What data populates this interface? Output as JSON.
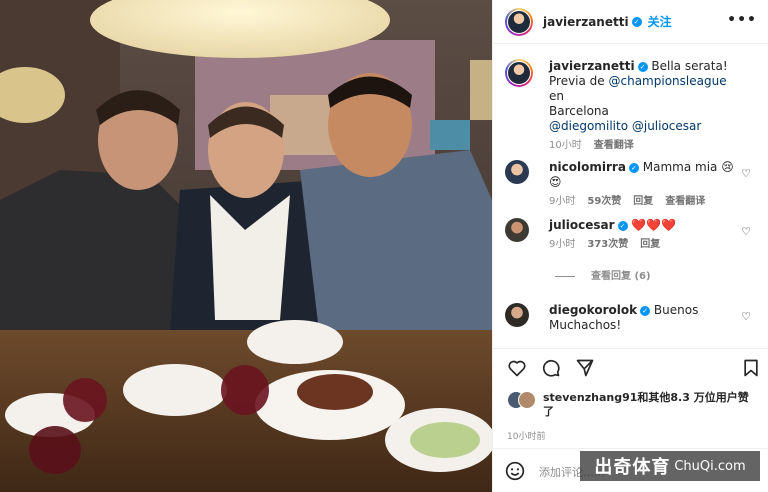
{
  "post": {
    "author": "javierzanetti",
    "follow_label": "关注",
    "more_label": "•••",
    "caption_author": "javierzanetti",
    "caption_text": "Bella serata!",
    "caption_line2": "Previa de ",
    "caption_link1": "@championsleague",
    "caption_line2b": " en",
    "caption_line3": "Barcelona",
    "caption_link2": "@diegomilito",
    "caption_link3": "@juliocesar",
    "caption_time": "10小时",
    "caption_translate": "查看翻译"
  },
  "comments": [
    {
      "user": "nicolomirra",
      "text": "Mamma mia",
      "emoji": "😢😍",
      "time": "9小时",
      "likes": "59次赞",
      "reply": "回复",
      "translate": "查看翻译"
    },
    {
      "user": "juliocesar",
      "text": "",
      "emoji": "❤️❤️❤️",
      "time": "9小时",
      "likes": "373次赞",
      "reply": "回复"
    },
    {
      "view_replies": "查看回复 (6)"
    },
    {
      "user": "diegokorolok",
      "text": "Buenos Muchachos!",
      "time": ""
    }
  ],
  "likes": {
    "text": "stevenzhang91和其他8.3 万位用户赞了",
    "time": "10小时前"
  },
  "add_comment_placeholder": "添加评论……",
  "watermark": {
    "cn": "出奇体育",
    "en": "ChuQi.com"
  },
  "colors": {
    "accent": "#0095f6",
    "link": "#00376b",
    "muted": "#8e8e8e",
    "heart": "#ed4956"
  }
}
